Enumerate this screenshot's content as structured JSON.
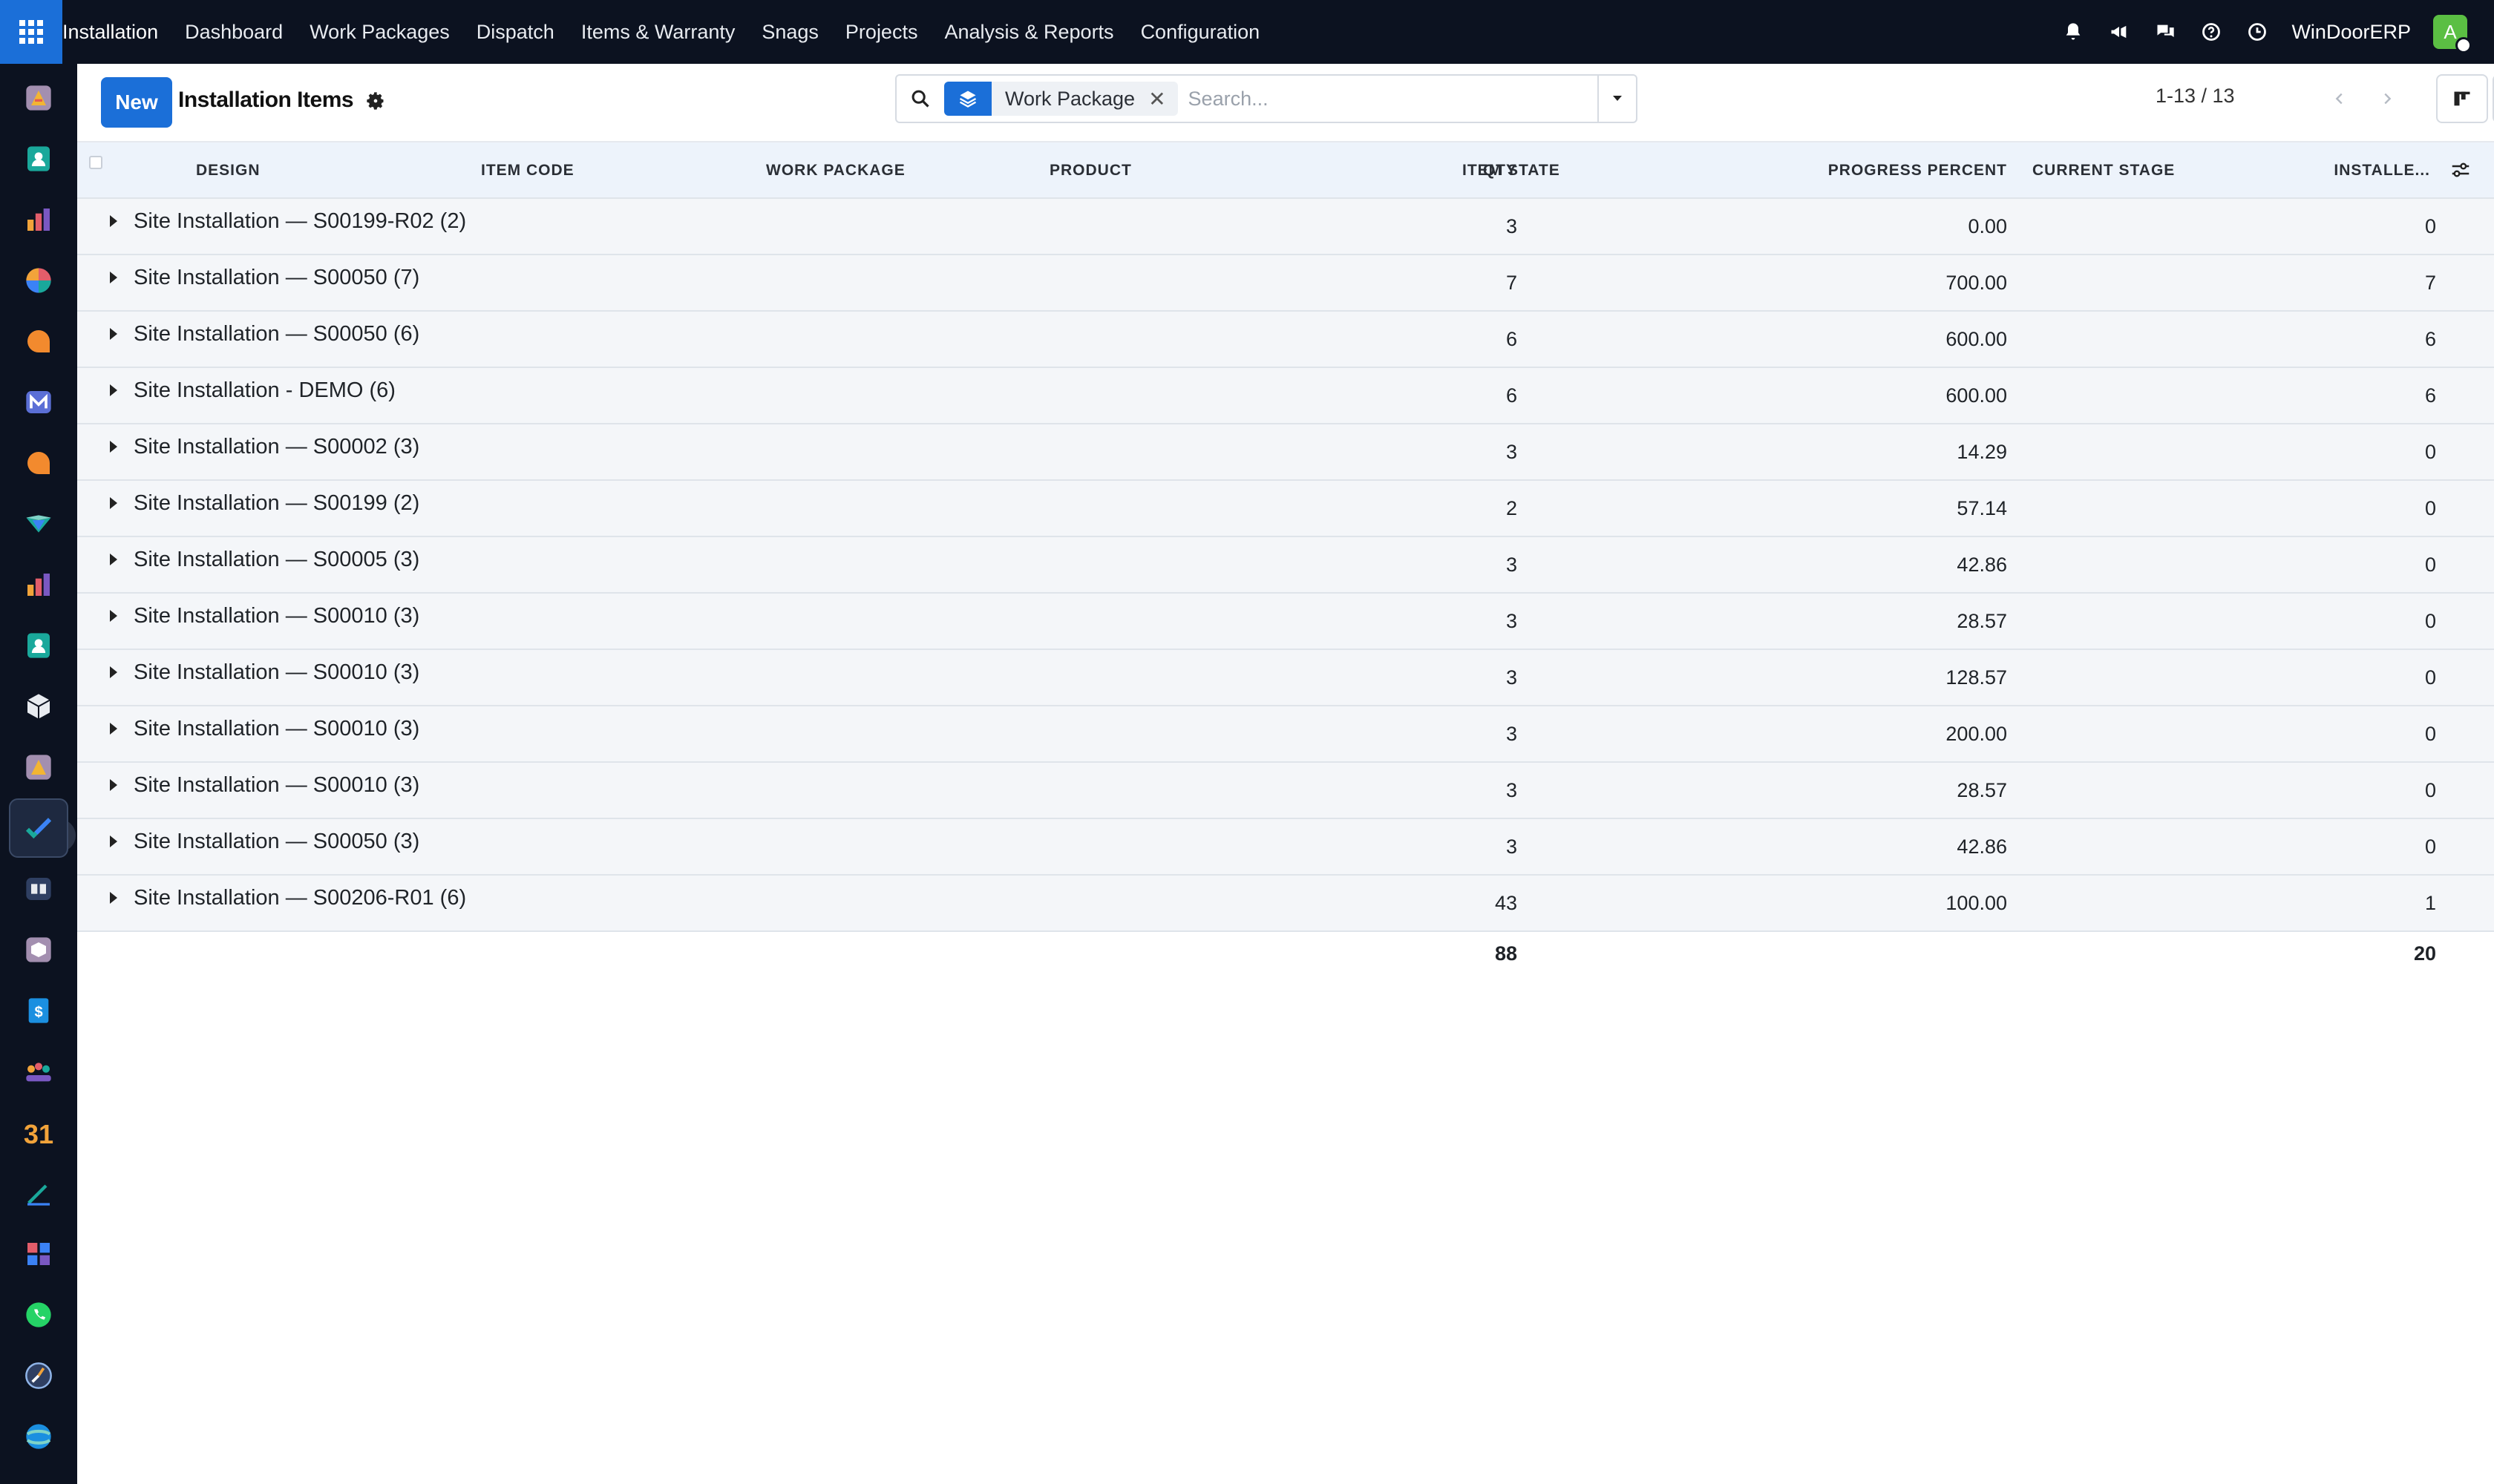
{
  "nav": {
    "brand": "Installation",
    "items": [
      "Dashboard",
      "Work Packages",
      "Dispatch",
      "Items & Warranty",
      "Snags",
      "Projects",
      "Analysis & Reports",
      "Configuration"
    ],
    "company": "WinDoorERP",
    "avatar_letter": "A"
  },
  "control": {
    "new_label": "New",
    "title": "Installation Items",
    "facet_label": "Work Package",
    "facet_close": "✕",
    "search_placeholder": "Search...",
    "pager": "1-13 / 13"
  },
  "table": {
    "headers": {
      "design": "Design",
      "item_code": "Item Code",
      "work_package": "Work Package",
      "product": "Product",
      "qty": "Qty",
      "item_state": "Item State",
      "progress": "Progress Percent",
      "stage": "Current Stage",
      "installed": "Installe..."
    },
    "groups": [
      {
        "label": "Site Installation — S00199-R02 (2)",
        "qty": "3",
        "progress": "0.00",
        "installed": "0"
      },
      {
        "label": "Site Installation — S00050 (7)",
        "qty": "7",
        "progress": "700.00",
        "installed": "7"
      },
      {
        "label": "Site Installation — S00050 (6)",
        "qty": "6",
        "progress": "600.00",
        "installed": "6"
      },
      {
        "label": "Site Installation - DEMO (6)",
        "qty": "6",
        "progress": "600.00",
        "installed": "6"
      },
      {
        "label": "Site Installation — S00002 (3)",
        "qty": "3",
        "progress": "14.29",
        "installed": "0"
      },
      {
        "label": "Site Installation — S00199 (2)",
        "qty": "2",
        "progress": "57.14",
        "installed": "0"
      },
      {
        "label": "Site Installation — S00005 (3)",
        "qty": "3",
        "progress": "42.86",
        "installed": "0"
      },
      {
        "label": "Site Installation — S00010 (3)",
        "qty": "3",
        "progress": "28.57",
        "installed": "0"
      },
      {
        "label": "Site Installation — S00010 (3)",
        "qty": "3",
        "progress": "128.57",
        "installed": "0"
      },
      {
        "label": "Site Installation — S00010 (3)",
        "qty": "3",
        "progress": "200.00",
        "installed": "0"
      },
      {
        "label": "Site Installation — S00010 (3)",
        "qty": "3",
        "progress": "28.57",
        "installed": "0"
      },
      {
        "label": "Site Installation — S00050 (3)",
        "qty": "3",
        "progress": "42.86",
        "installed": "0"
      },
      {
        "label": "Site Installation — S00206-R01 (6)",
        "qty": "43",
        "progress": "100.00",
        "installed": "1"
      }
    ],
    "totals": {
      "qty": "88",
      "installed": "20"
    }
  },
  "rail_icons": [
    "installation-app-icon",
    "contacts-app-icon",
    "reports-app-icon",
    "analytics-app-icon",
    "discuss-app-icon",
    "email-app-icon",
    "chat-app-icon",
    "knowledge-app-icon",
    "dashboard-app-icon",
    "employees-app-icon",
    "inventory-app-icon",
    "project-app-icon",
    "tasks-app-icon",
    "documentation-app-icon",
    "product-app-icon",
    "invoicing-app-icon",
    "team-app-icon",
    "calendar-app-icon",
    "sign-app-icon",
    "spreadsheet-app-icon",
    "whatsapp-app-icon",
    "timesheet-app-icon",
    "website-app-icon"
  ]
}
